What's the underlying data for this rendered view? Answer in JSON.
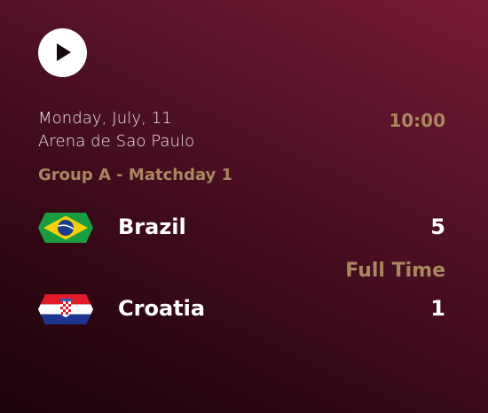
{
  "match": {
    "date": "Monday, July, 11",
    "venue": "Arena de Sao Paulo",
    "time": "10:00",
    "group": "Group A - Matchday 1",
    "status": "Full Time"
  },
  "home": {
    "name": "Brazil",
    "score": "5",
    "flag_icon": "brazil-flag-icon"
  },
  "away": {
    "name": "Croatia",
    "score": "1",
    "flag_icon": "croatia-flag-icon"
  },
  "colors": {
    "accent": "#a8875f",
    "background_top": "#761a34",
    "background_bottom": "#1b0309"
  },
  "icons": {
    "play": "play-icon"
  }
}
